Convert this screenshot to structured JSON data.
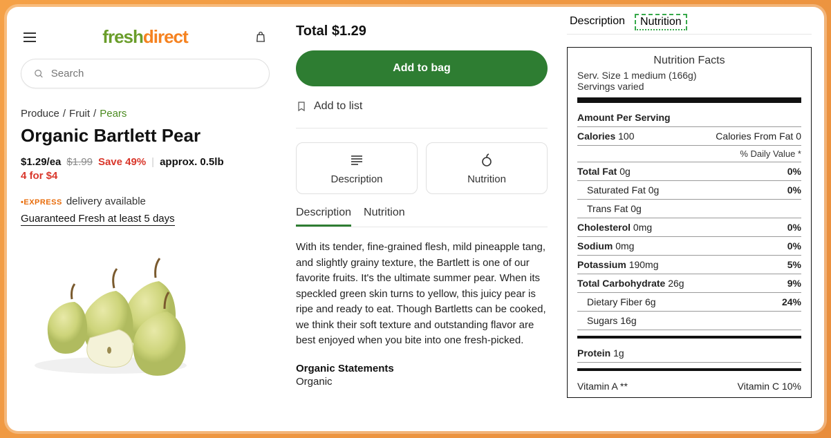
{
  "logo": {
    "p1": "fresh",
    "p2": "direct"
  },
  "search": {
    "placeholder": "Search"
  },
  "breadcrumb": {
    "a": "Produce",
    "b": "Fruit",
    "c": "Pears"
  },
  "title": "Organic Bartlett Pear",
  "price": {
    "each": "$1.29/ea",
    "old": "$1.99",
    "save": "Save 49%",
    "approx": "approx. 0.5lb",
    "deal": "4 for $4"
  },
  "express_label": "•EXPRESS",
  "delivery_text": "delivery available",
  "guarantee": "Guaranteed Fresh at least 5 days",
  "mid": {
    "total": "Total $1.29",
    "addbag": "Add to bag",
    "addlist": "Add to list",
    "btn_desc": "Description",
    "btn_nut": "Nutrition",
    "tab_desc": "Description",
    "tab_nut": "Nutrition",
    "description": "With its tender, fine-grained flesh, mild pineapple tang, and slightly grainy texture, the Bartlett is one of our favorite fruits. It's the ultimate summer pear. When its speckled green skin turns to yellow, this juicy pear is ripe and ready to eat. Though Bartletts can be cooked, we think their soft texture and outstanding flavor are best enjoyed when you bite into one fresh-picked.",
    "org_h": "Organic Statements",
    "org_v": "Organic"
  },
  "right": {
    "tab_desc": "Description",
    "tab_nut": "Nutrition"
  },
  "nf": {
    "title": "Nutrition Facts",
    "serv": "Serv. Size 1 medium (166g)",
    "servings": "Servings varied",
    "aps": "Amount Per Serving",
    "cal_l": "Calories",
    "cal_v": "100",
    "cff": "Calories From Fat 0",
    "dvhead": "% Daily Value *",
    "tfat_l": "Total Fat",
    "tfat_v": "0g",
    "tfat_p": "0%",
    "sfat_l": "Saturated Fat 0g",
    "sfat_p": "0%",
    "trans_l": "Trans Fat 0g",
    "chol_l": "Cholesterol",
    "chol_v": "0mg",
    "chol_p": "0%",
    "sod_l": "Sodium",
    "sod_v": "0mg",
    "sod_p": "0%",
    "pot_l": "Potassium",
    "pot_v": "190mg",
    "pot_p": "5%",
    "carb_l": "Total Carbohydrate",
    "carb_v": "26g",
    "carb_p": "9%",
    "fib_l": "Dietary Fiber 6g",
    "fib_p": "24%",
    "sug_l": "Sugars 16g",
    "prot_l": "Protein",
    "prot_v": "1g",
    "vita": "Vitamin A **",
    "vitc": "Vitamin C 10%"
  }
}
